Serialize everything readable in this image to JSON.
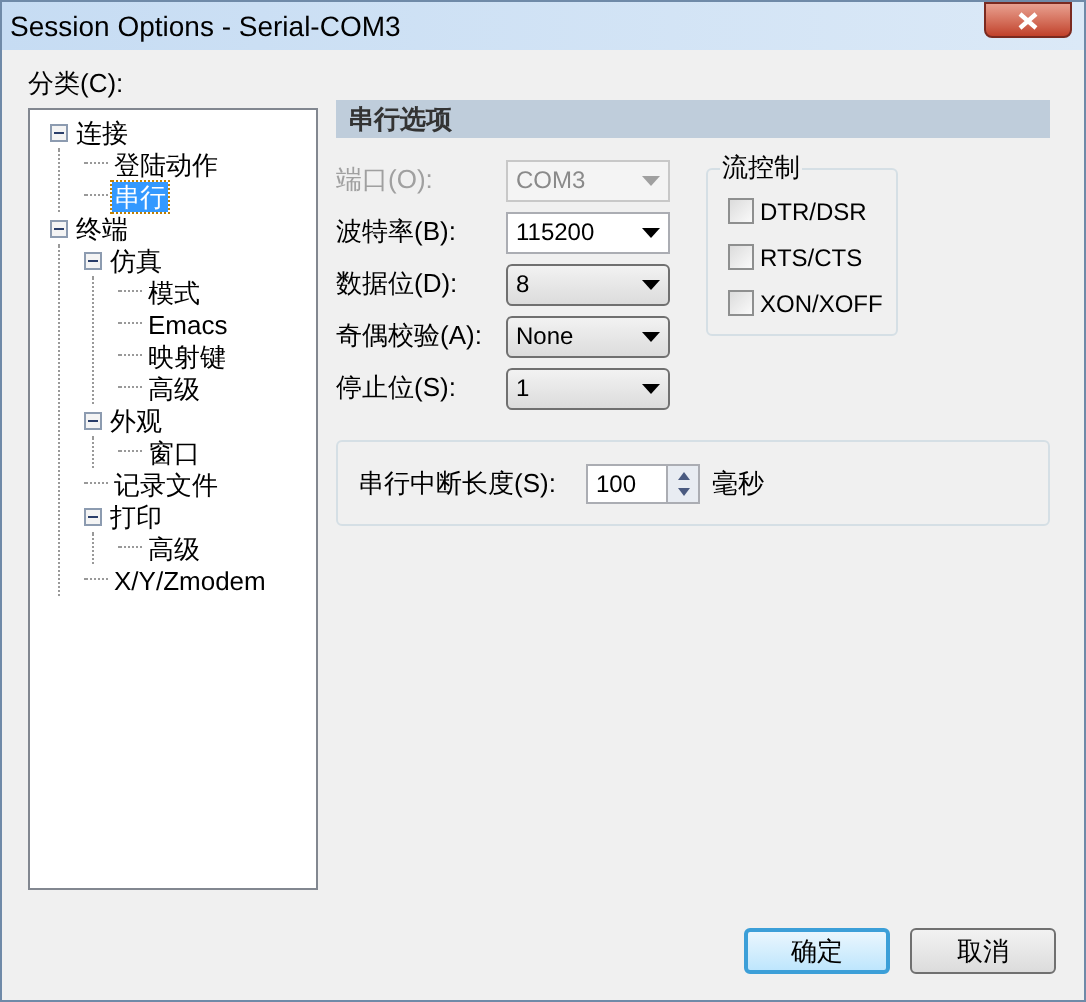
{
  "window": {
    "title": "Session Options - Serial-COM3"
  },
  "category_label": "分类(C):",
  "tree": [
    {
      "label": "连接",
      "selected": false,
      "expanded": true,
      "children": [
        {
          "label": "登陆动作",
          "selected": false
        },
        {
          "label": "串行",
          "selected": true
        }
      ]
    },
    {
      "label": "终端",
      "selected": false,
      "expanded": true,
      "children": [
        {
          "label": "仿真",
          "selected": false,
          "expanded": true,
          "children": [
            {
              "label": "模式",
              "selected": false
            },
            {
              "label": "Emacs",
              "selected": false
            },
            {
              "label": "映射键",
              "selected": false
            },
            {
              "label": "高级",
              "selected": false
            }
          ]
        },
        {
          "label": "外观",
          "selected": false,
          "expanded": true,
          "children": [
            {
              "label": "窗口",
              "selected": false
            }
          ]
        },
        {
          "label": "记录文件",
          "selected": false
        },
        {
          "label": "打印",
          "selected": false,
          "expanded": true,
          "children": [
            {
              "label": "高级",
              "selected": false
            }
          ]
        },
        {
          "label": "X/Y/Zmodem",
          "selected": false
        }
      ]
    }
  ],
  "section_title": "串行选项",
  "fields": [
    {
      "label": "端口(O):",
      "value": "COM3",
      "disabled": true
    },
    {
      "label": "波特率(B):",
      "value": "115200",
      "disabled": false
    },
    {
      "label": "数据位(D):",
      "value": "8",
      "disabled": false
    },
    {
      "label": "奇偶校验(A):",
      "value": "None",
      "disabled": false
    },
    {
      "label": "停止位(S):",
      "value": "1",
      "disabled": false
    }
  ],
  "flow_control": {
    "title": "流控制",
    "options": [
      {
        "label": "DTR/DSR",
        "checked": false
      },
      {
        "label": "RTS/CTS",
        "checked": false
      },
      {
        "label": "XON/XOFF",
        "checked": false
      }
    ]
  },
  "break_length": {
    "label": "串行中断长度(S):",
    "value": "100",
    "unit": "毫秒"
  },
  "buttons": [
    {
      "label": "确定",
      "default": true
    },
    {
      "label": "取消",
      "default": false
    }
  ]
}
